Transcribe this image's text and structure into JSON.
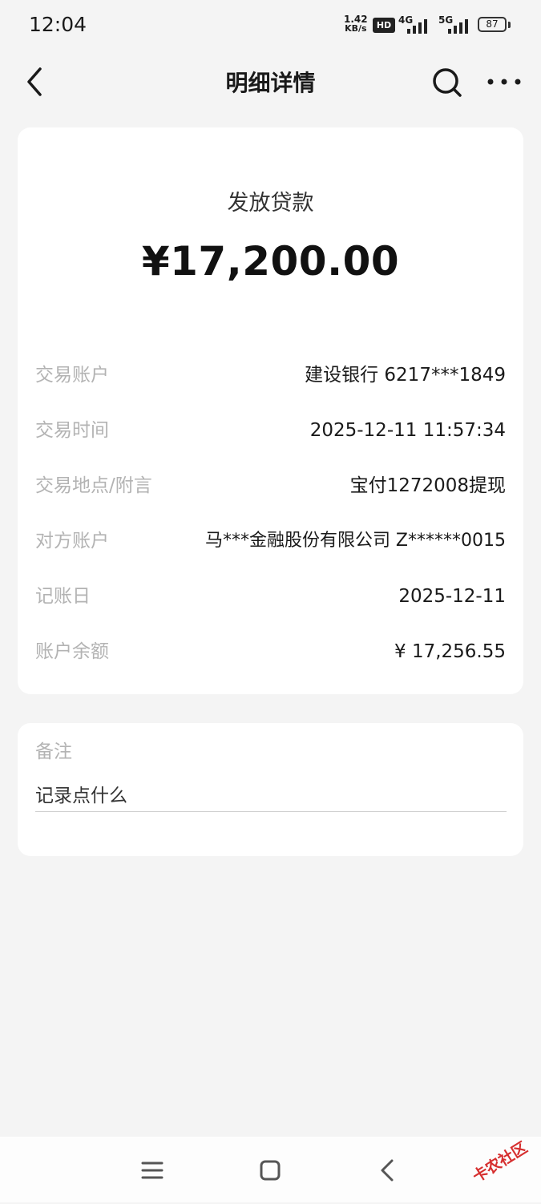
{
  "status_bar": {
    "time": "12:04",
    "speed_value": "1.42",
    "speed_unit": "KB/s",
    "hd": "HD",
    "net1": "4G",
    "net2": "5G",
    "battery": "87"
  },
  "nav": {
    "title": "明细详情",
    "back_icon": "chevron-left-icon",
    "search_icon": "search-icon",
    "more_icon": "more-horizontal-icon"
  },
  "transaction": {
    "type": "发放贷款",
    "amount": "¥17,200.00",
    "rows": [
      {
        "label": "交易账户",
        "value": "建设银行 6217***1849"
      },
      {
        "label": "交易时间",
        "value": "2025-12-11 11:57:34"
      },
      {
        "label": "交易地点/附言",
        "value": "宝付1272008提现"
      },
      {
        "label": "对方账户",
        "value": "马***金融股份有限公司 Z******0015"
      },
      {
        "label": "记账日",
        "value": "2025-12-11"
      },
      {
        "label": "账户余额",
        "value": "¥ 17,256.55"
      }
    ]
  },
  "note": {
    "label": "备注",
    "placeholder": "记录点什么"
  },
  "watermark": "卡农社区"
}
